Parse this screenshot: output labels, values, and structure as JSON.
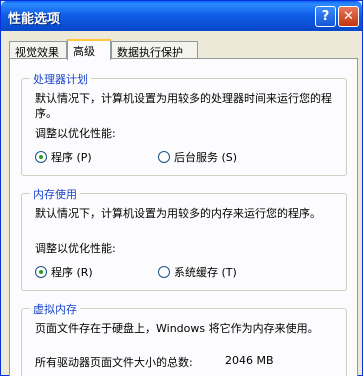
{
  "window": {
    "title": "性能选项",
    "help_label": "?",
    "close_label": "✕"
  },
  "tabs": [
    {
      "label": "视觉效果",
      "active": false
    },
    {
      "label": "高级",
      "active": true
    },
    {
      "label": "数据执行保护",
      "active": false
    }
  ],
  "processor": {
    "title": "处理器计划",
    "desc": "默认情况下，计算机设置为用较多的处理器时间来运行您的程序。",
    "adjust_label": "调整以优化性能:",
    "opt_programs": "程序 (P)",
    "opt_services": "后台服务 (S)",
    "selected": "programs"
  },
  "memory": {
    "title": "内存使用",
    "desc": "默认情况下，计算机设置为用较多的内存来运行您的程序。",
    "adjust_label": "调整以优化性能:",
    "opt_programs": "程序 (R)",
    "opt_cache": "系统缓存 (T)",
    "selected": "programs"
  },
  "virtual_memory": {
    "title": "虚拟内存",
    "desc": "页面文件存在于硬盘上，Windows 将它作为内存来使用。",
    "total_label": "所有驱动器页面文件大小的总数:",
    "total_value": "2046 MB"
  },
  "colors": {
    "title_bar": "#0A5FE6",
    "group_title": "#1A45C8",
    "active_tab_accent": "#FFC83C",
    "dialog_bg": "#ECE9D8"
  }
}
